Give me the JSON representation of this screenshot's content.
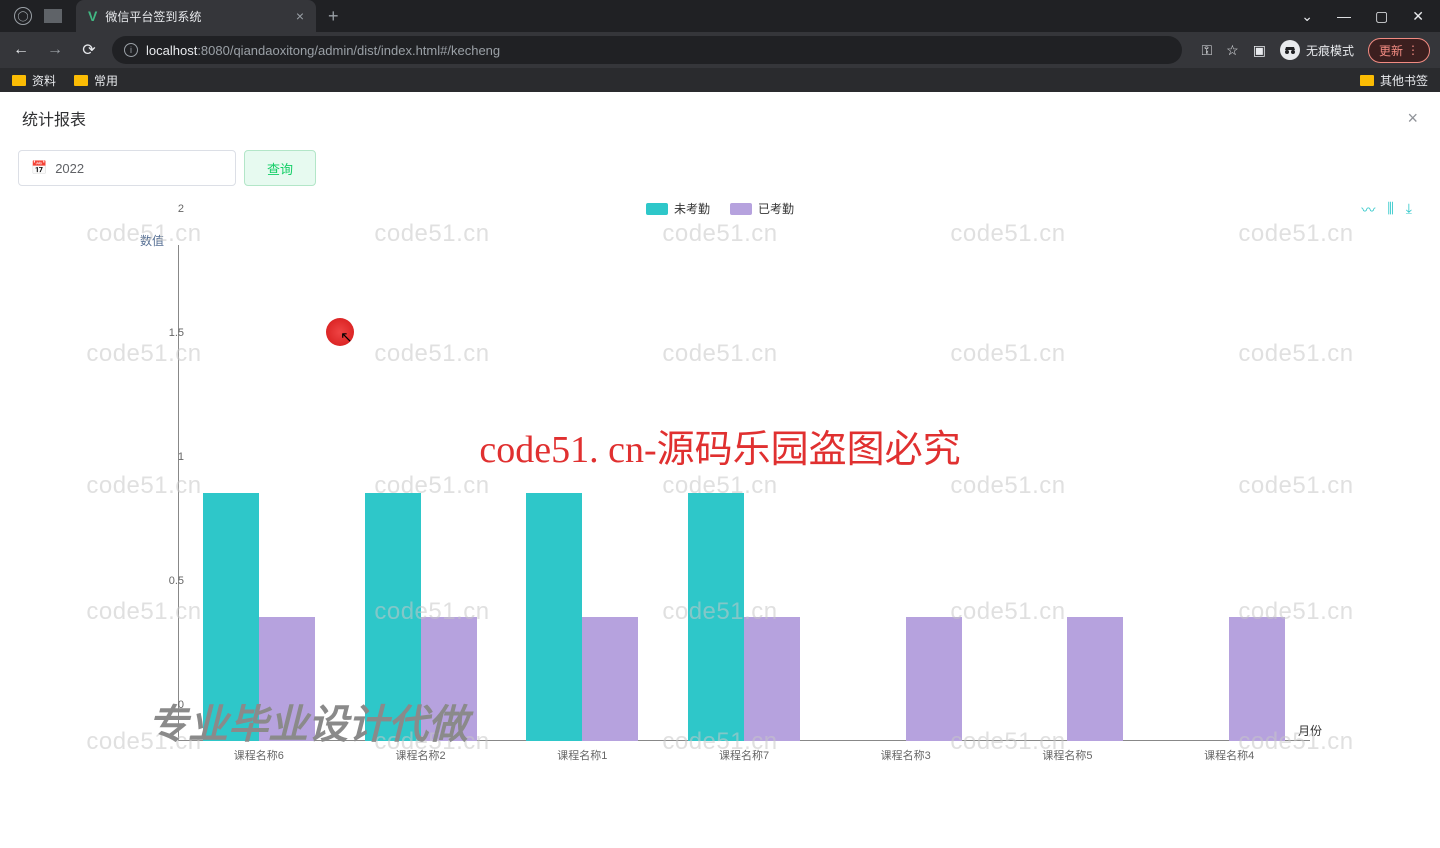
{
  "browser": {
    "tab_title": "微信平台签到系统",
    "url_host": "localhost",
    "url_path": ":8080/qiandaoxitong/admin/dist/index.html#/kecheng",
    "incognito_label": "无痕模式",
    "update_label": "更新",
    "bookmarks": {
      "b1": "资料",
      "b2": "常用",
      "other": "其他书签"
    }
  },
  "modal": {
    "title": "统计报表"
  },
  "toolbar": {
    "year_value": "2022",
    "query_label": "查询"
  },
  "chart_tools": {
    "line": "〰",
    "bar": "⫼",
    "download": "⤓"
  },
  "legend": {
    "series1": "未考勤",
    "series2": "已考勤"
  },
  "axis": {
    "y_title": "数值",
    "x_title": "月份"
  },
  "watermark": {
    "repeat": "code51.cn",
    "center": "code51. cn-源码乐园盗图必究",
    "bottom_left": "专业毕业设计代做"
  },
  "chart_data": {
    "type": "bar",
    "title": "",
    "xlabel": "月份",
    "ylabel": "数值",
    "ylim": [
      0,
      2
    ],
    "yticks": [
      0,
      0.5,
      1,
      1.5,
      2
    ],
    "categories": [
      "课程名称6",
      "课程名称2",
      "课程名称1",
      "课程名称7",
      "课程名称3",
      "课程名称5",
      "课程名称4"
    ],
    "series": [
      {
        "name": "未考勤",
        "color": "#2ec7c9",
        "values": [
          1,
          1,
          1,
          1,
          0,
          0,
          0
        ]
      },
      {
        "name": "已考勤",
        "color": "#b6a2de",
        "values": [
          0.5,
          0.5,
          0.5,
          0.5,
          0.5,
          0.5,
          0.5
        ]
      }
    ]
  }
}
